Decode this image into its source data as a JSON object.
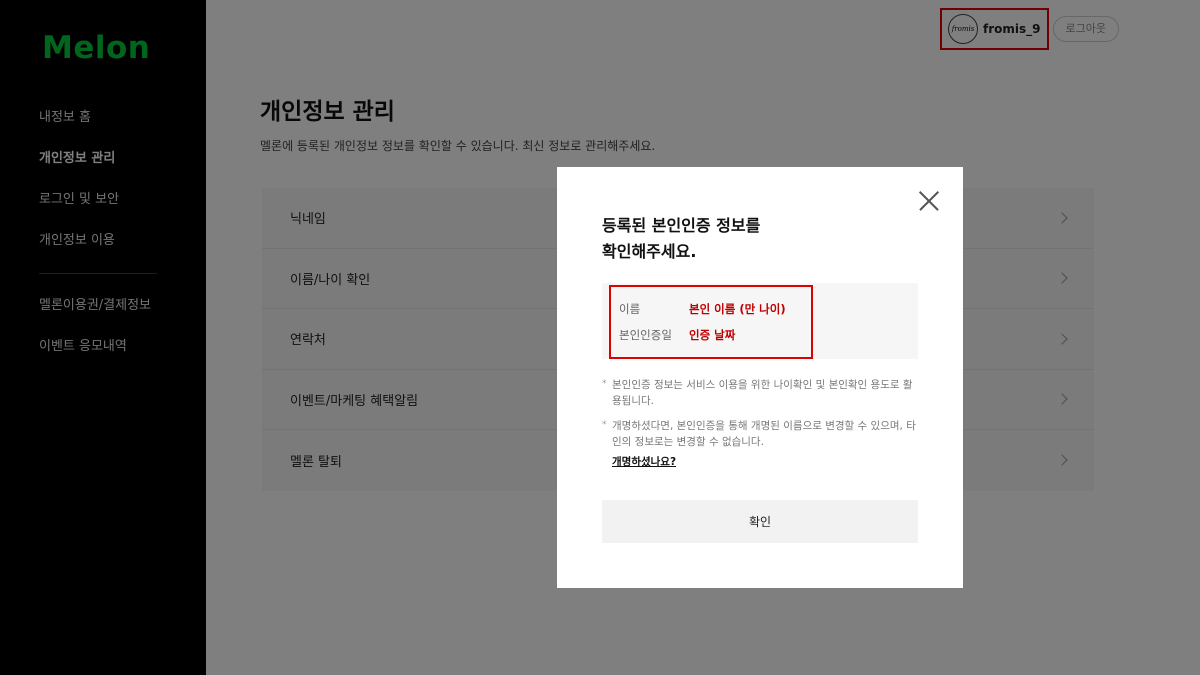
{
  "sidebar": {
    "logo": "Melon",
    "items": [
      {
        "label": "내정보 홈"
      },
      {
        "label": "개인정보 관리"
      },
      {
        "label": "로그인 및 보안"
      },
      {
        "label": "개인정보 이용"
      },
      {
        "label": "멜론이용권/결제정보"
      },
      {
        "label": "이벤트 응모내역"
      }
    ]
  },
  "header": {
    "avatar_text": "fromis",
    "username": "fromis_9",
    "logout_label": "로그아웃"
  },
  "main": {
    "title": "개인정보 관리",
    "description": "멜론에 등록된 개인정보 정보를 확인할 수 있습니다. 최신 정보로 관리해주세요.",
    "menu": [
      {
        "label": "닉네임"
      },
      {
        "label": "이름/나이 확인"
      },
      {
        "label": "연락처"
      },
      {
        "label": "이벤트/마케팅 혜택알림"
      },
      {
        "label": "멜론 탈퇴"
      }
    ]
  },
  "modal": {
    "title_line1": "등록된 본인인증 정보를",
    "title_line2": "확인해주세요.",
    "info": {
      "name_key": "이름",
      "name_value": "본인 이름 (만 나이)",
      "date_key": "본인인증일",
      "date_value": "인증 날짜"
    },
    "notes": [
      "본인인증 정보는 서비스 이용을 위한 나이확인 및 본인확인 용도로 활용됩니다.",
      "개명하셨다면, 본인인증을 통해 개명된 이름으로 변경할 수 있으며, 타인의 정보로는 변경할 수 없습니다."
    ],
    "link_label": "개명하셨나요?",
    "confirm_label": "확인"
  },
  "colors": {
    "brand": "#00cd3c",
    "highlight": "#e00000",
    "value_red": "#c00000"
  }
}
